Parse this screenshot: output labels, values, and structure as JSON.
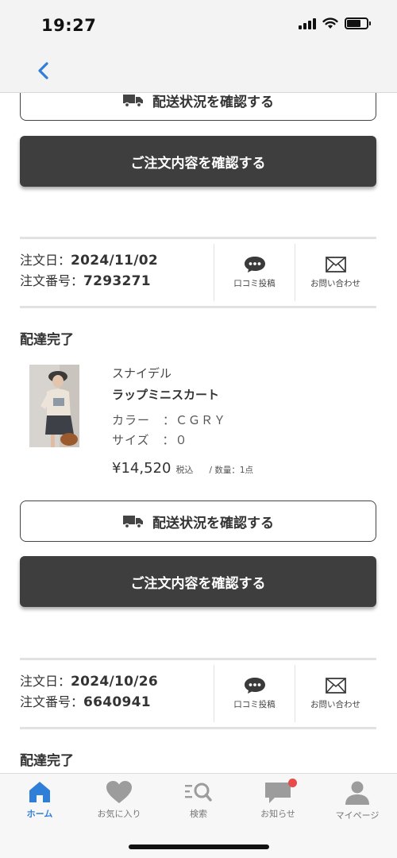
{
  "status_bar": {
    "time": "19:27"
  },
  "orders": [
    {
      "track_label": "配送状況を確認する",
      "detail_label": "ご注文内容を確認する"
    },
    {
      "order_date_label": "注文日：",
      "order_date": "2024/11/02",
      "order_number_label": "注文番号：",
      "order_number": "7293271",
      "review_label": "口コミ投稿",
      "contact_label": "お問い合わせ",
      "status": "配達完了",
      "product": {
        "brand": "スナイデル",
        "name": "ラップミニスカート",
        "color_line": "カラー　：ＣＧＲＹ",
        "size_line": "サイズ　：０",
        "price": "¥14,520",
        "tax": "税込",
        "quantity": "/ 数量：1点"
      },
      "track_label": "配送状況を確認する",
      "detail_label": "ご注文内容を確認する"
    },
    {
      "order_date_label": "注文日：",
      "order_date": "2024/10/26",
      "order_number_label": "注文番号：",
      "order_number": "6640941",
      "review_label": "口コミ投稿",
      "contact_label": "お問い合わせ",
      "status": "配達完了"
    }
  ],
  "tab_bar": {
    "items": [
      {
        "label": "ホーム",
        "icon": "home-icon",
        "active": true
      },
      {
        "label": "お気に入り",
        "icon": "heart-icon",
        "active": false
      },
      {
        "label": "検索",
        "icon": "search-icon",
        "active": false
      },
      {
        "label": "お知らせ",
        "icon": "chat-icon",
        "active": false,
        "badge": true
      },
      {
        "label": "マイページ",
        "icon": "person-icon",
        "active": false
      }
    ]
  },
  "colors": {
    "accent": "#2f7fd9",
    "dark_button": "#3e3e3e",
    "badge": "#e84b4b"
  }
}
